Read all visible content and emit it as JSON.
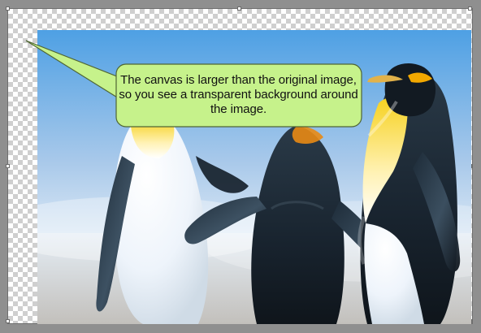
{
  "callout": {
    "text": "The canvas is larger than the original image, so you see a transparent background around the image.",
    "fill": "#c6f28b",
    "stroke": "#5a6d3b"
  },
  "canvas": {
    "checker_light": "#ffffff",
    "checker_dark": "#cfcfcf",
    "frame": "#8f8f8f"
  },
  "photo": {
    "sky_top": "#5aa7e6",
    "sky_bottom": "#d7e6f2",
    "ground": "#c9c5c0"
  }
}
